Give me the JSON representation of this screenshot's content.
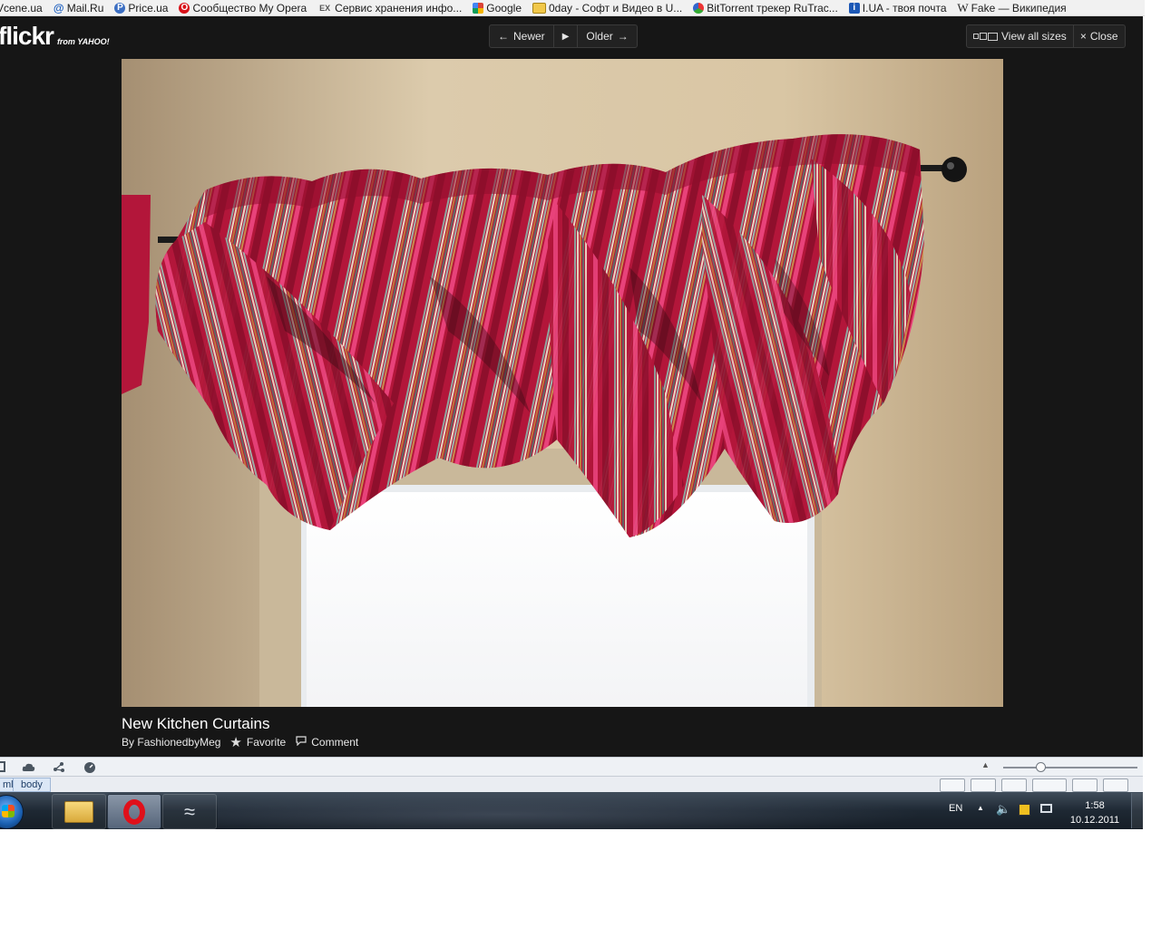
{
  "bookmarks": [
    {
      "label": "Vcene.ua",
      "icon": "vcene-icon"
    },
    {
      "label": "Mail.Ru",
      "icon": "at-sign-icon"
    },
    {
      "label": "Price.ua",
      "icon": "price-ua-icon"
    },
    {
      "label": "Сообщество My Opera",
      "icon": "opera-icon"
    },
    {
      "label": "Сервис хранения инфо...",
      "icon": "ex-icon"
    },
    {
      "label": "Google",
      "icon": "google-icon"
    },
    {
      "label": "0day - Софт и Видео в U...",
      "icon": "folder-icon"
    },
    {
      "label": "BitTorrent трекер RuTrac...",
      "icon": "rutracker-icon"
    },
    {
      "label": "I.UA - твоя почта",
      "icon": "info-icon"
    },
    {
      "label": "Fake — Википедия",
      "icon": "wikipedia-icon"
    }
  ],
  "lightbox": {
    "logo_main": "flickr",
    "logo_sub": "from YAHOO!",
    "nav": {
      "newer": "Newer",
      "play": "▶",
      "older": "Older"
    },
    "view_all_sizes": "View all sizes",
    "close": "Close",
    "photo": {
      "title": "New Kitchen Curtains",
      "by_prefix": "By",
      "author": "FashionedbyMeg",
      "favorite": "Favorite",
      "comment": "Comment"
    }
  },
  "browser": {
    "dom_breadcrumb": [
      "ml",
      "body"
    ]
  },
  "taskbar": {
    "language": "EN",
    "time": "1:58",
    "date": "10.12.2011"
  },
  "colors": {
    "lightbox_bg": "#161616",
    "valance_red": "#b3163a",
    "wall": "#d6c2a0"
  }
}
